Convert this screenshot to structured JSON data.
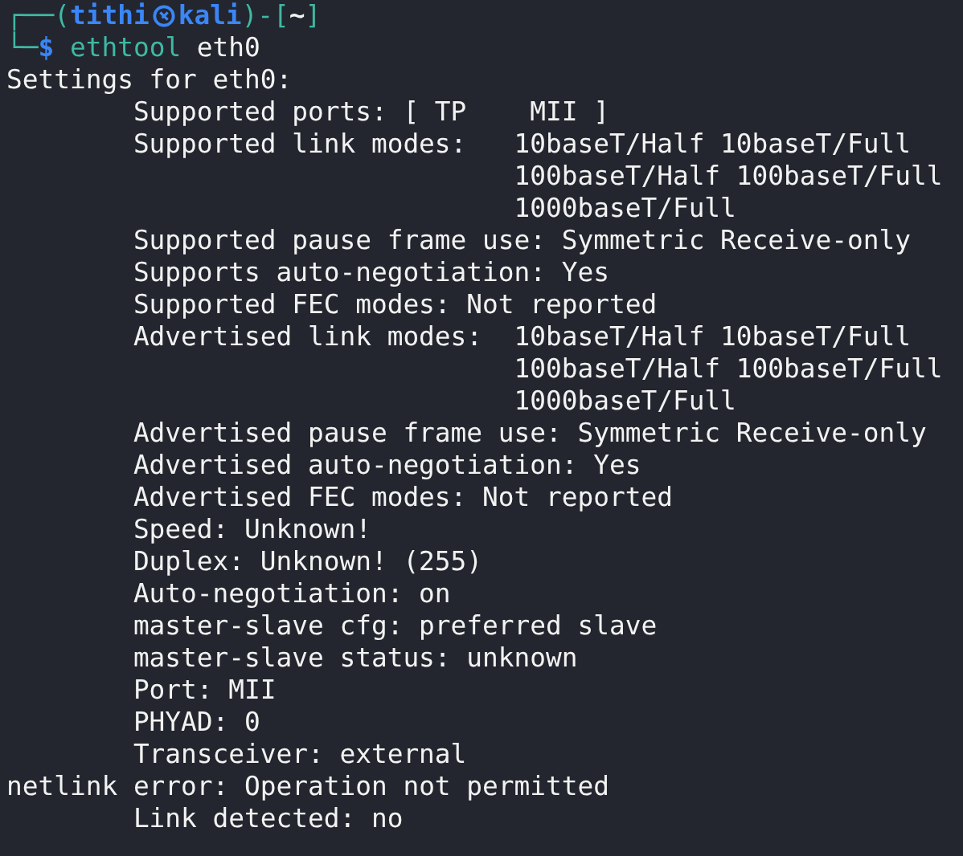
{
  "prompt": {
    "open": "┌──(",
    "user": "tithi",
    "host": "kali",
    "mid": ")-[",
    "cwd": "~",
    "close": "]",
    "corner": "└─",
    "symbol": "$",
    "command": "ethtool",
    "argument": "eth0"
  },
  "output": [
    {
      "kind": "plain",
      "text": "Settings for eth0:"
    },
    {
      "kind": "indented",
      "text": "Supported ports: [ TP    MII ]"
    },
    {
      "kind": "indented",
      "text": "Supported link modes:   10baseT/Half 10baseT/Full"
    },
    {
      "kind": "continuation",
      "text": "100baseT/Half 100baseT/Full"
    },
    {
      "kind": "continuation",
      "text": "1000baseT/Full"
    },
    {
      "kind": "indented",
      "text": "Supported pause frame use: Symmetric Receive-only"
    },
    {
      "kind": "indented",
      "text": "Supports auto-negotiation: Yes"
    },
    {
      "kind": "indented",
      "text": "Supported FEC modes: Not reported"
    },
    {
      "kind": "indented",
      "text": "Advertised link modes:  10baseT/Half 10baseT/Full"
    },
    {
      "kind": "continuation",
      "text": "100baseT/Half 100baseT/Full"
    },
    {
      "kind": "continuation",
      "text": "1000baseT/Full"
    },
    {
      "kind": "indented",
      "text": "Advertised pause frame use: Symmetric Receive-only"
    },
    {
      "kind": "indented",
      "text": "Advertised auto-negotiation: Yes"
    },
    {
      "kind": "indented",
      "text": "Advertised FEC modes: Not reported"
    },
    {
      "kind": "indented",
      "text": "Speed: Unknown!"
    },
    {
      "kind": "indented",
      "text": "Duplex: Unknown! (255)"
    },
    {
      "kind": "indented",
      "text": "Auto-negotiation: on"
    },
    {
      "kind": "indented",
      "text": "master-slave cfg: preferred slave"
    },
    {
      "kind": "indented",
      "text": "master-slave status: unknown"
    },
    {
      "kind": "indented",
      "text": "Port: MII"
    },
    {
      "kind": "indented",
      "text": "PHYAD: 0"
    },
    {
      "kind": "indented",
      "text": "Transceiver: external"
    },
    {
      "kind": "plain",
      "text": "netlink error: Operation not permitted"
    },
    {
      "kind": "indented",
      "text": "Link detected: no"
    }
  ]
}
